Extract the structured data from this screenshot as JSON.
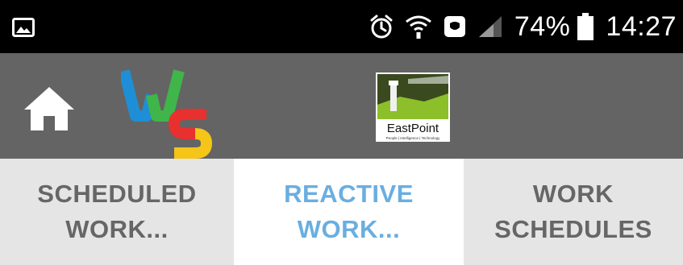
{
  "status_bar": {
    "battery_percent": "74%",
    "time": "14:27",
    "icons": [
      "image-icon",
      "alarm-icon",
      "wifi-icon",
      "shield-notification-icon",
      "signal-icon",
      "battery-icon"
    ]
  },
  "app_bar": {
    "home_icon": "home-icon",
    "app_logo_letters": [
      "W",
      "S"
    ],
    "brand_logo": {
      "name": "EastPoint",
      "tagline": "People | Intelligence | Technology"
    }
  },
  "tabs": [
    {
      "line1": "SCHEDULED",
      "line2": "WORK...",
      "active": false
    },
    {
      "line1": "REACTIVE",
      "line2": "WORK...",
      "active": true
    },
    {
      "line1": "WORK",
      "line2": "SCHEDULES",
      "active": false
    }
  ],
  "colors": {
    "status_bar_bg": "#000000",
    "app_bar_bg": "#646464",
    "tab_bg": "#e5e5e5",
    "tab_active_bg": "#ffffff",
    "tab_text": "#666666",
    "tab_active_text": "#6aaee0",
    "logo_w_blue": "#1e8fd6",
    "logo_w_green": "#3fb54a",
    "logo_s_red": "#e8302f",
    "logo_s_yellow": "#f5c518"
  }
}
